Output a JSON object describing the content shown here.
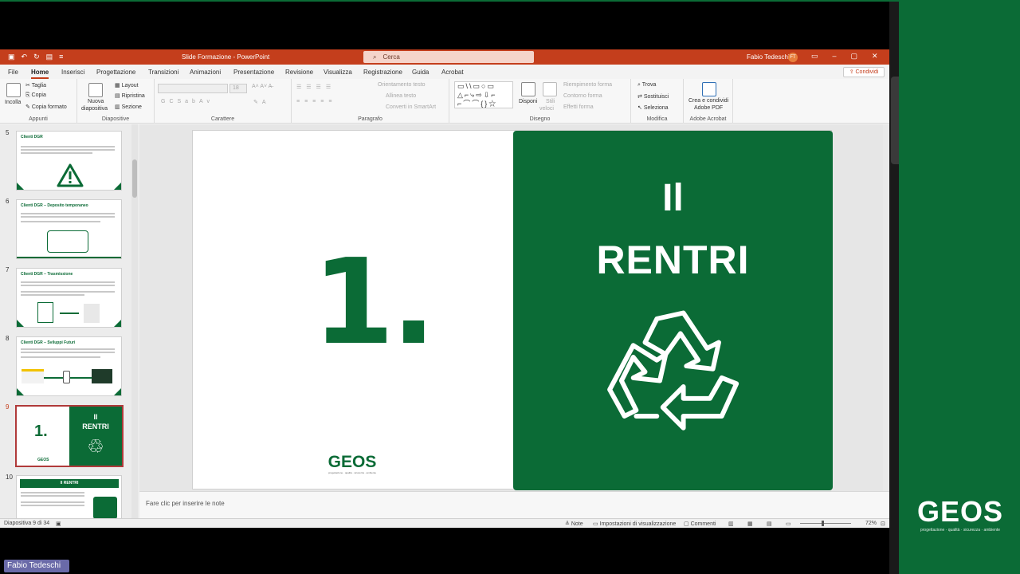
{
  "window": {
    "title": "Slide Formazione - PowerPoint",
    "search_placeholder": "Cerca",
    "user": "Fabio Tedeschi",
    "user_initials": "FT"
  },
  "tabs": [
    "File",
    "Home",
    "Inserisci",
    "Progettazione",
    "Transizioni",
    "Animazioni",
    "Presentazione",
    "Revisione",
    "Visualizza",
    "Registrazione",
    "Guida",
    "Acrobat"
  ],
  "active_tab": "Home",
  "share_label": "Condividi",
  "ribbon": {
    "clipboard": {
      "paste": "Incolla",
      "cut": "Taglia",
      "copy": "Copia",
      "format_painter": "Copia formato",
      "label": "Appunti"
    },
    "slides": {
      "new_slide_1": "Nuova",
      "new_slide_2": "diapositiva",
      "layout": "Layout",
      "reset": "Ripristina",
      "section": "Sezione",
      "label": "Diapositive"
    },
    "font": {
      "size": "18",
      "label": "Carattere"
    },
    "paragraph": {
      "text_direction": "Orientamento testo",
      "align_text": "Allinea testo",
      "smartart": "Converti in SmartArt",
      "label": "Paragrafo"
    },
    "drawing": {
      "arrange": "Disponi",
      "quick_styles_1": "Stili",
      "quick_styles_2": "veloci",
      "shape_fill": "Riempimento forma",
      "shape_outline": "Contorno forma",
      "shape_effects": "Effetti forma",
      "label": "Disegno"
    },
    "editing": {
      "find": "Trova",
      "replace": "Sostituisci",
      "select": "Seleziona",
      "label": "Modifica"
    },
    "acrobat": {
      "create_1": "Crea e condividi",
      "create_2": "Adobe PDF",
      "label": "Adobe Acrobat"
    }
  },
  "thumbnails": [
    {
      "num": "5",
      "title": "Clienti DGR"
    },
    {
      "num": "6",
      "title": "Clienti DGR – Deposito temporaneo"
    },
    {
      "num": "7",
      "title": "Clienti DGR – Trasmissione"
    },
    {
      "num": "8",
      "title": "Clienti DGR – Sviluppi Futuri"
    },
    {
      "num": "9",
      "title": "",
      "big": "1.",
      "green_l1": "Il",
      "green_l2": "RENTRI",
      "logo": "GEOS"
    },
    {
      "num": "10",
      "title": "Il RENTRI"
    }
  ],
  "slide": {
    "number_text": "1.",
    "green_line1": "Il",
    "green_line2": "RENTRI",
    "logo": "GEOS",
    "logo_tagline": "progettazione · qualità · sicurezza · ambiente"
  },
  "notes_placeholder": "Fare clic per inserire le note",
  "status": {
    "slide_counter": "Diapositiva 9 di 34",
    "notes": "Note",
    "display_settings": "Impostazioni di visualizzazione",
    "comments": "Commenti",
    "zoom": "72%"
  },
  "brand": {
    "logo": "GEOS",
    "tagline": "progettazione · qualità · sicurezza · ambiente"
  },
  "participant_name": "Fabio Tedeschi",
  "colors": {
    "brand_green": "#0b6b36",
    "ppt_accent": "#c43e1c"
  }
}
